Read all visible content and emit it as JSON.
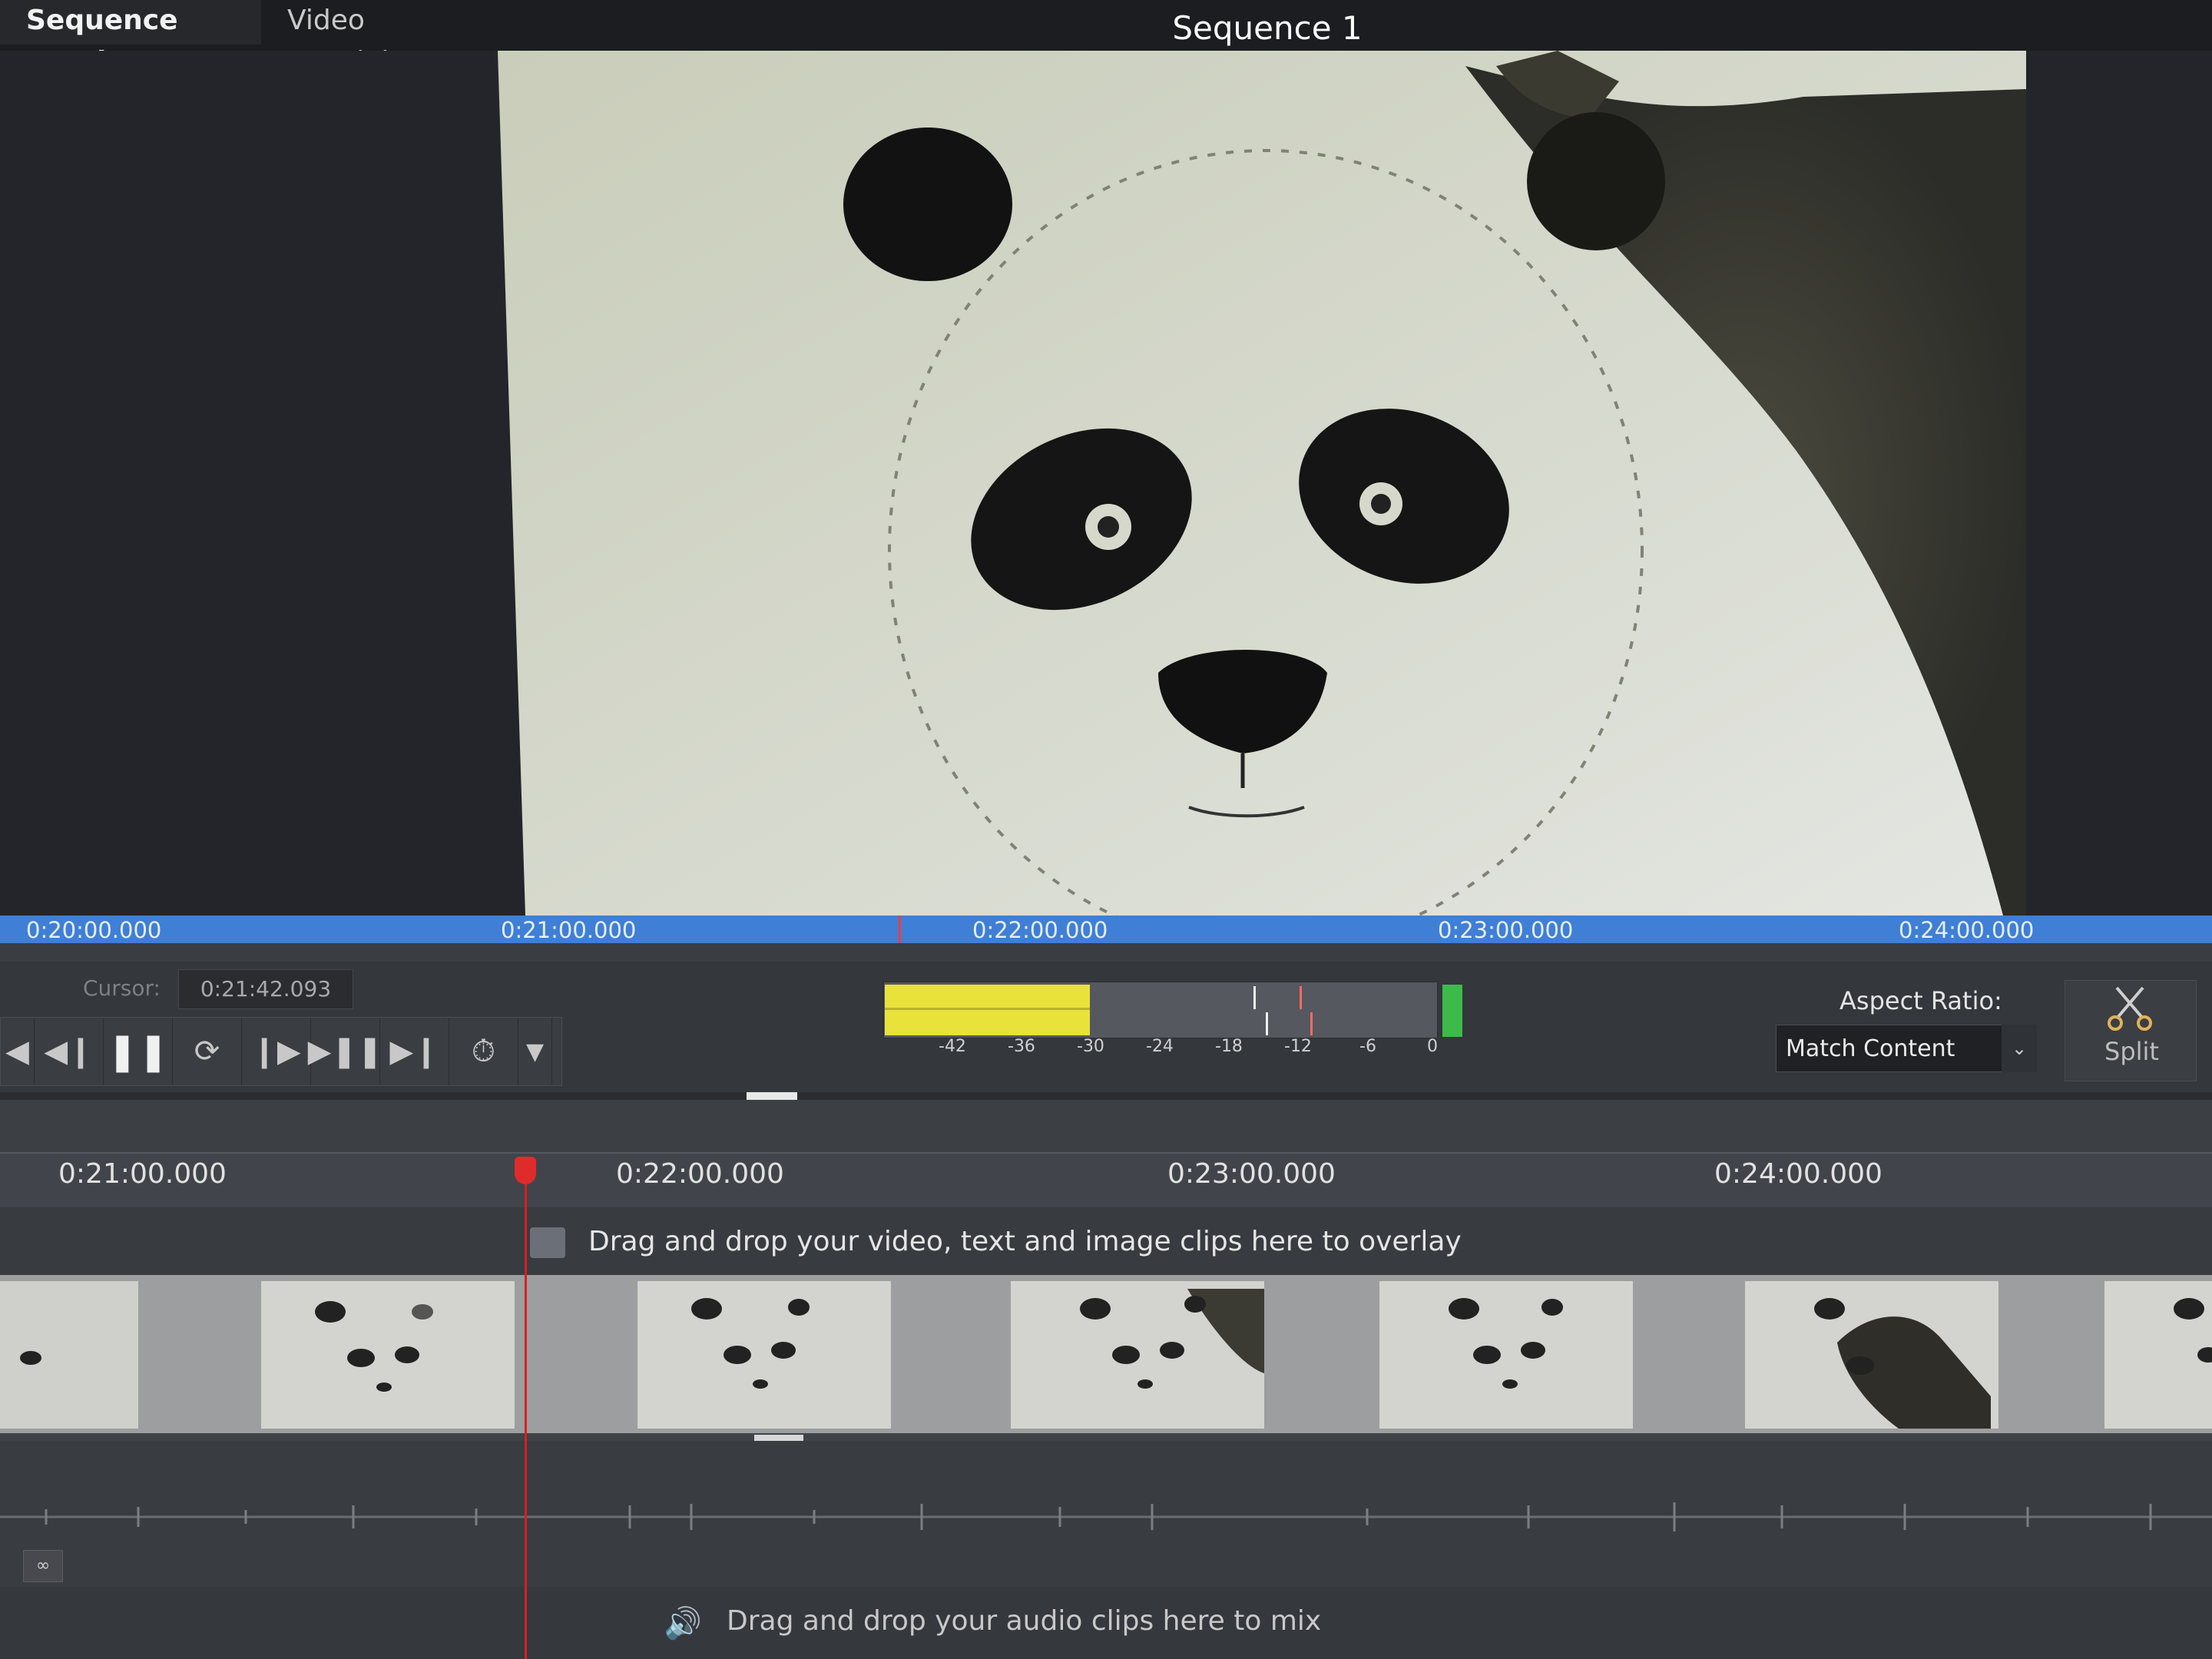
{
  "tabs": {
    "sequence_preview": "Sequence Preview",
    "video_tutorials": "Video Tutorials",
    "close_glyph": "×"
  },
  "sequence_title": "Sequence 1",
  "preview_ruler": [
    "0:20:00.000",
    "0:21:00.000",
    "0:22:00.000",
    "0:23:00.000",
    "0:24:00.000"
  ],
  "cursor": {
    "label": "Cursor:",
    "value": "0:21:42.093"
  },
  "transport_icons": [
    "skip-back-icon",
    "step-back-icon",
    "pause-icon",
    "loop-icon",
    "step-forward-icon",
    "play-to-end-icon",
    "skip-end-icon",
    "speed-icon",
    "dropdown-icon"
  ],
  "meter": {
    "labels": [
      "-42",
      "-36",
      "-30",
      "-24",
      "-18",
      "-12",
      "-6",
      "0"
    ],
    "level_fraction": 0.37
  },
  "aspect_ratio": {
    "label": "Aspect Ratio:",
    "value": "Match Content"
  },
  "split_button": "Split",
  "timeline_ruler": [
    "0:21:00.000",
    "0:22:00.000",
    "0:23:00.000",
    "0:24:00.000"
  ],
  "overlay_hint": "Drag and drop your video, text and image clips here to overlay",
  "audio_hint": "Drag and drop your audio clips here to mix",
  "colors": {
    "accent_ruler": "#3f7fd6",
    "playhead": "#e02b2b",
    "meter_level": "#e8e23b",
    "meter_peak": "#3dbb4a"
  }
}
